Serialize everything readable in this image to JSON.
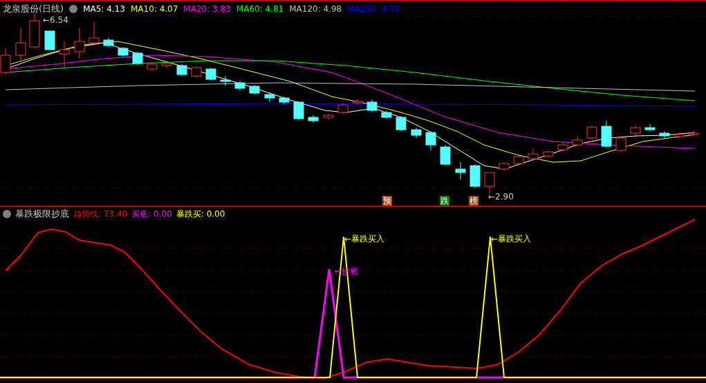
{
  "price_panel": {
    "title": "龙泉股份(日线)",
    "indicators": [
      {
        "label": "MA5: 4.13",
        "color": "#ffffff"
      },
      {
        "label": "MA10: 4.07",
        "color": "#ffff00"
      },
      {
        "label": "MA20: 3.83",
        "color": "#ff00ff"
      },
      {
        "label": "MA60: 4.81",
        "color": "#00ff00"
      },
      {
        "label": "MA120: 4.98",
        "color": "#c0c0c0"
      },
      {
        "label": "MA250: 4.70",
        "color": "#0000ff"
      }
    ],
    "price_labels": [
      "←6.54",
      "←2.90"
    ],
    "signals": [
      {
        "text": "预",
        "color": "#c0400c"
      },
      {
        "text": "跌",
        "color": "#008000"
      },
      {
        "text": "榜",
        "color": "#a04a10"
      }
    ]
  },
  "indicator_panel": {
    "title": "暴跌极限抄底",
    "values": [
      {
        "label": "趋势线: 73.40",
        "color": "#ff0000"
      },
      {
        "label": "买底: 0.00",
        "color": "#ff00ff"
      },
      {
        "label": "暴跌买: 0.00",
        "color": "#ffff00"
      }
    ],
    "annotations": [
      {
        "text": "←暴跌买入",
        "color": "#ffff00"
      },
      {
        "text": "←暴跌买入",
        "color": "#ffff00"
      },
      {
        "text": "←抄底",
        "color": "#ff00ff"
      }
    ]
  }
}
